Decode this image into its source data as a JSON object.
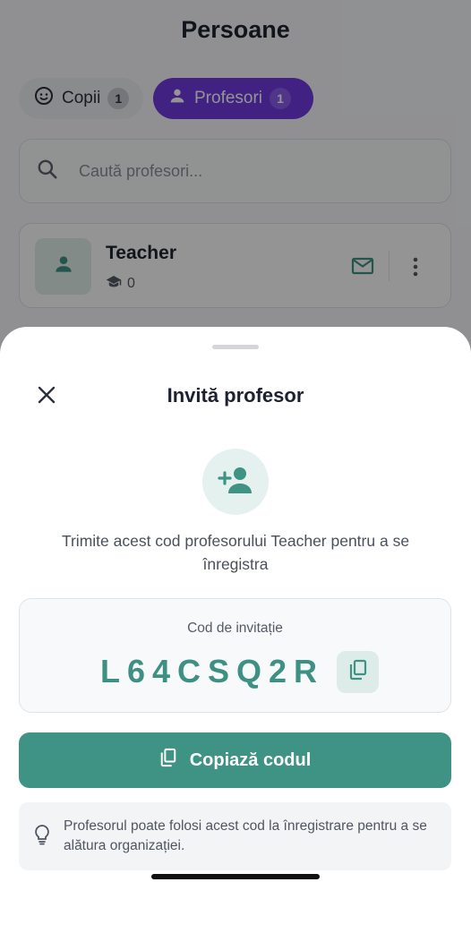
{
  "page": {
    "title": "Persoane"
  },
  "tabs": [
    {
      "label": "Copii",
      "count": "1",
      "active": false
    },
    {
      "label": "Profesori",
      "count": "1",
      "active": true
    }
  ],
  "search": {
    "placeholder": "Caută profesori..."
  },
  "teacher_card": {
    "name": "Teacher",
    "classes_count": "0"
  },
  "sheet": {
    "title": "Invită profesor",
    "description": "Trimite acest cod profesorului Teacher pentru a se înregistra",
    "code_label": "Cod de invitație",
    "code": "L64CSQ2R",
    "copy_button_label": "Copiază codul",
    "hint": "Profesorul poate folosi acest cod la înregistrare pentru a se alătura organizației."
  },
  "colors": {
    "accent_purple": "#7039e0",
    "accent_teal": "#3f9385",
    "code_teal": "#3d9083"
  },
  "icons": [
    "face-icon",
    "person-icon",
    "search-icon",
    "school-icon",
    "mail-icon",
    "more-vert-icon",
    "close-icon",
    "person-add-icon",
    "copy-icon",
    "lightbulb-icon"
  ]
}
